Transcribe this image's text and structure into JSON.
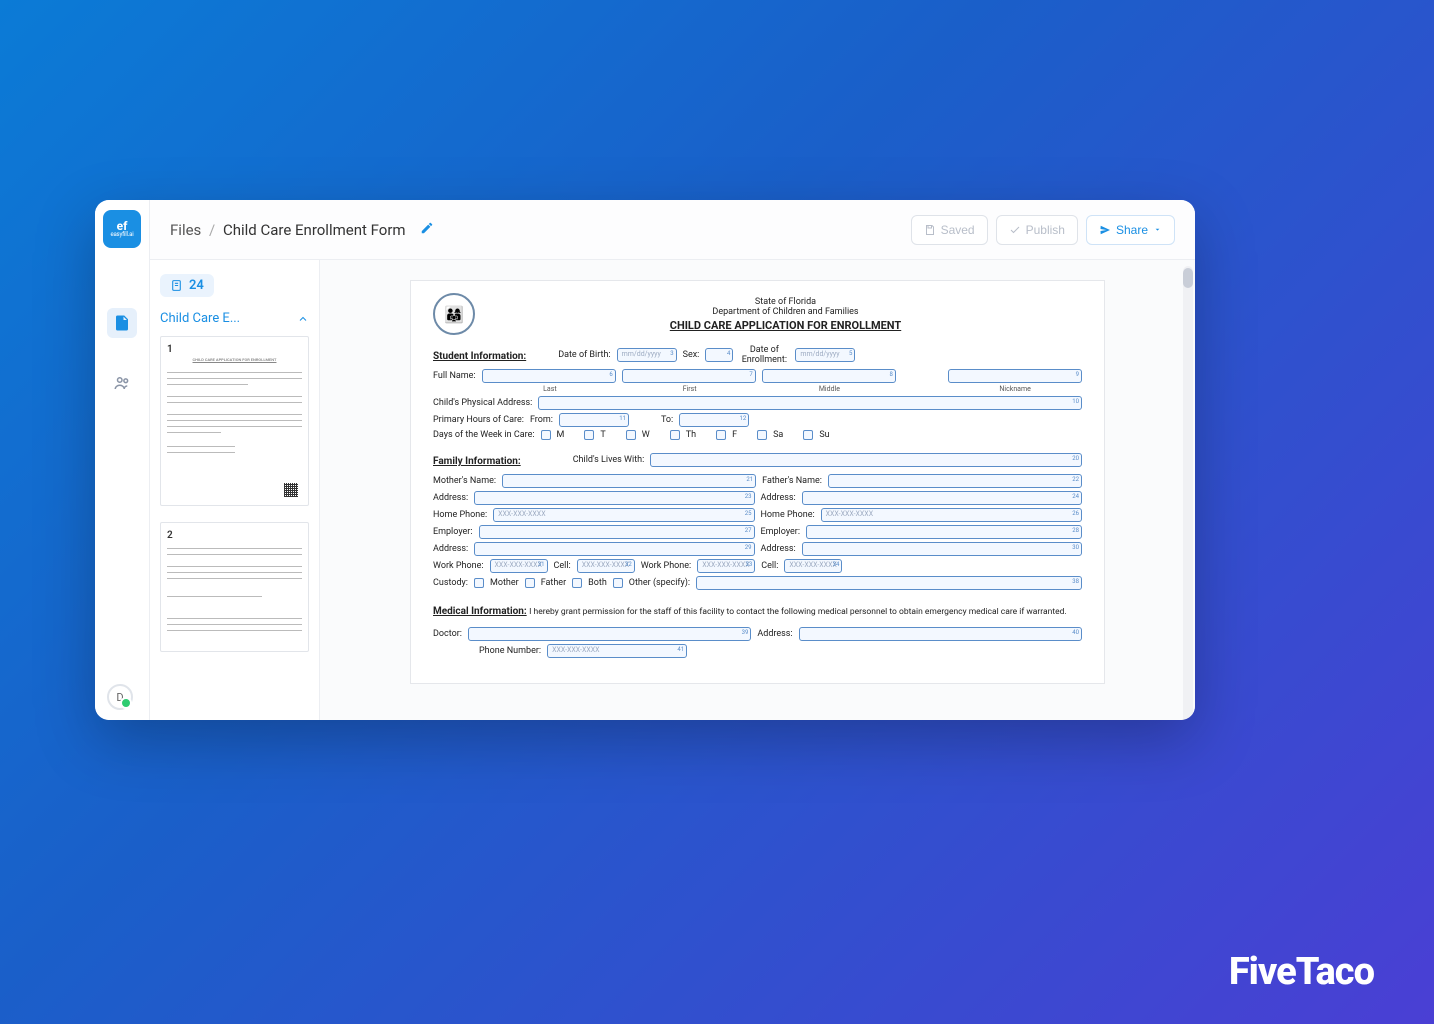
{
  "breadcrumb": {
    "root": "Files",
    "current": "Child Care Enrollment Form"
  },
  "topbar": {
    "saved": "Saved",
    "publish": "Publish",
    "share": "Share"
  },
  "sidebar": {
    "field_count": "24",
    "doc_name": "Child Care E...",
    "page1_title": "CHILD CARE APPLICATION FOR ENROLLMENT",
    "page2_title": ""
  },
  "logo": {
    "top": "ef",
    "bottom": "easyfill.ai"
  },
  "form": {
    "header": {
      "state": "State of Florida",
      "dept": "Department of Children and Families",
      "title": "CHILD CARE APPLICATION FOR ENROLLMENT"
    },
    "student": {
      "heading": "Student Information:",
      "dob_label": "Date of Birth:",
      "dob_ph": "mm/dd/yyyy",
      "sex_label": "Sex:",
      "enroll_label": "Date of Enrollment:",
      "enroll_ph": "mm/dd/yyyy",
      "fullname_label": "Full Name:",
      "last": "Last",
      "first": "First",
      "middle": "Middle",
      "nickname": "Nickname",
      "addr_label": "Child's Physical Address:",
      "hours_label": "Primary Hours of Care:",
      "from": "From:",
      "to": "To:",
      "days_label": "Days of the Week in Care:",
      "days": [
        "M",
        "T",
        "W",
        "Th",
        "F",
        "Sa",
        "Su"
      ]
    },
    "family": {
      "heading": "Family Information:",
      "lives_with": "Child's Lives With:",
      "mother": "Mother's Name:",
      "father": "Father's Name:",
      "address": "Address:",
      "home_phone": "Home Phone:",
      "employer": "Employer:",
      "work_phone": "Work Phone:",
      "cell": "Cell:",
      "phone_ph": "XXX-XXX-XXXX",
      "custody": "Custody:",
      "c_mother": "Mother",
      "c_father": "Father",
      "c_both": "Both",
      "c_other": "Other (specify):"
    },
    "medical": {
      "heading": "Medical Information:",
      "consent": "I hereby grant permission for the staff of this facility to contact the following medical personnel to obtain emergency medical care if warranted.",
      "doctor": "Doctor:",
      "address": "Address:",
      "phone": "Phone Number:",
      "phone_ph": "XXX-XXX-XXXX"
    }
  },
  "avatar_initial": "D",
  "watermark": "FiveTaco"
}
